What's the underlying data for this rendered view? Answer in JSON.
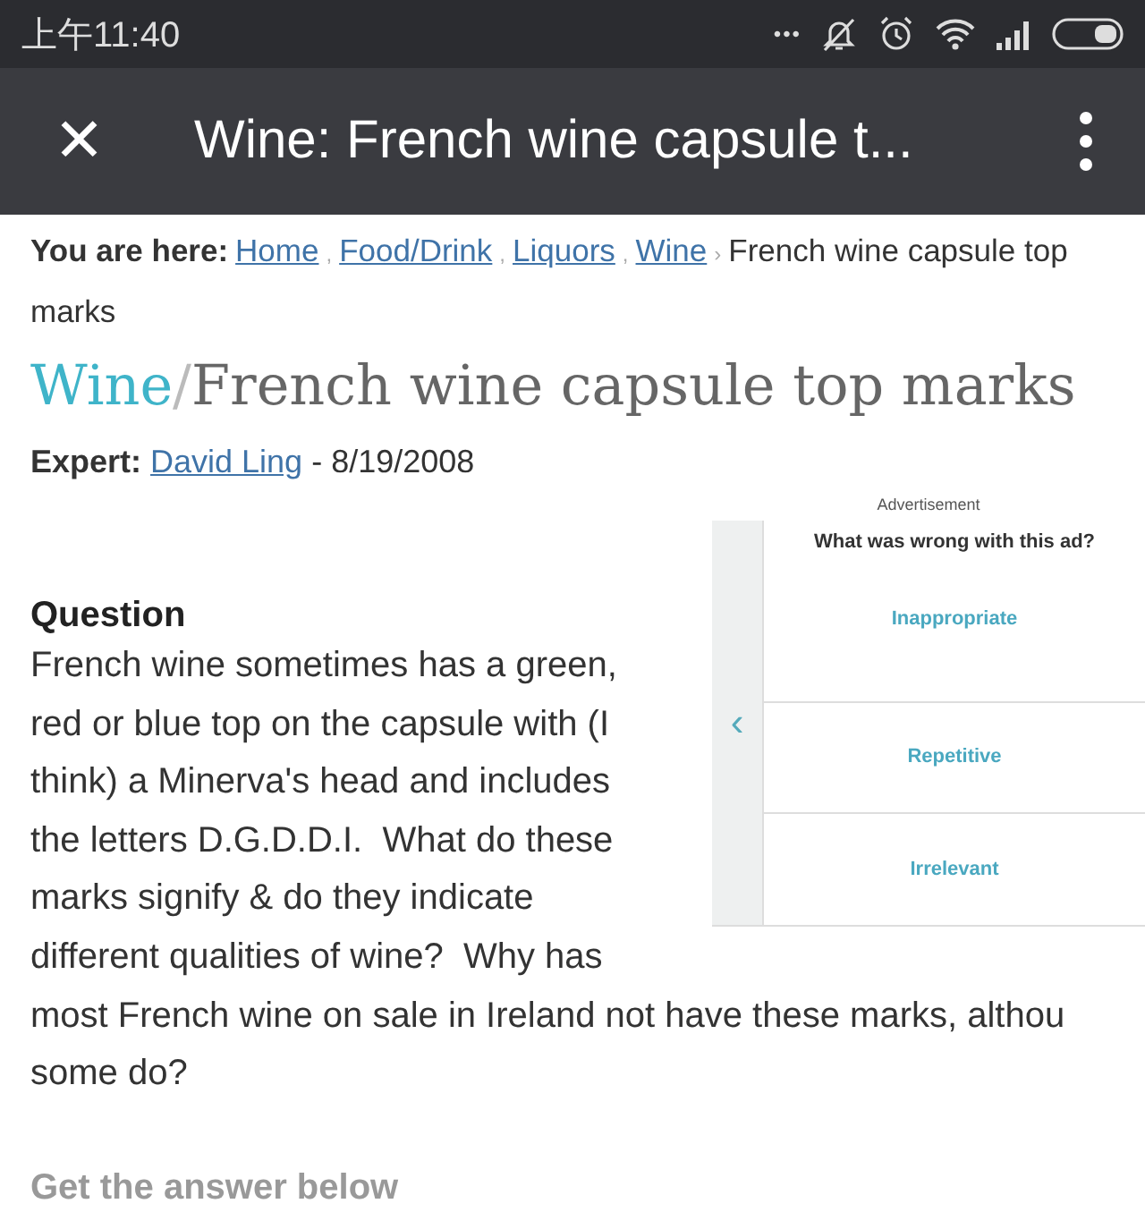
{
  "status_bar": {
    "time": "上午11:40",
    "dots": "•••"
  },
  "app_bar": {
    "close": "✕",
    "title": "Wine: French wine capsule t..."
  },
  "breadcrumb": {
    "label": "You are here:",
    "items": [
      {
        "kind": "link",
        "text": "Home",
        "separator": ","
      },
      {
        "kind": "link",
        "text": "Food/Drink",
        "separator": ","
      },
      {
        "kind": "link",
        "text": "Liquors",
        "separator": ","
      },
      {
        "kind": "link",
        "text": "Wine",
        "separator": "›"
      },
      {
        "kind": "current",
        "text": "French wine capsule top"
      },
      {
        "kind": "current",
        "text": "marks"
      }
    ]
  },
  "heading": {
    "category": "Wine",
    "slash": "/",
    "title": "French wine capsule top marks"
  },
  "expert": {
    "label": "Expert:",
    "name": "David Ling",
    "date": "- 8/19/2008"
  },
  "ad": {
    "label": "Advertisement",
    "question": "What was wrong with this ad?",
    "back": "‹",
    "options": [
      "Inappropriate",
      "Repetitive",
      "Irrelevant"
    ]
  },
  "question": {
    "heading": "Question",
    "lines": [
      "French wine sometimes has a green,",
      "red or blue top on the capsule with (I",
      "think) a Minerva's head and includes",
      "the letters D.G.D.D.I.  What do these",
      "marks signify & do they indicate",
      "different qualities of wine?  Why has",
      "most French wine on sale in Ireland not have these marks, althou",
      "some do?"
    ]
  },
  "answer_link": "Get the answer below"
}
